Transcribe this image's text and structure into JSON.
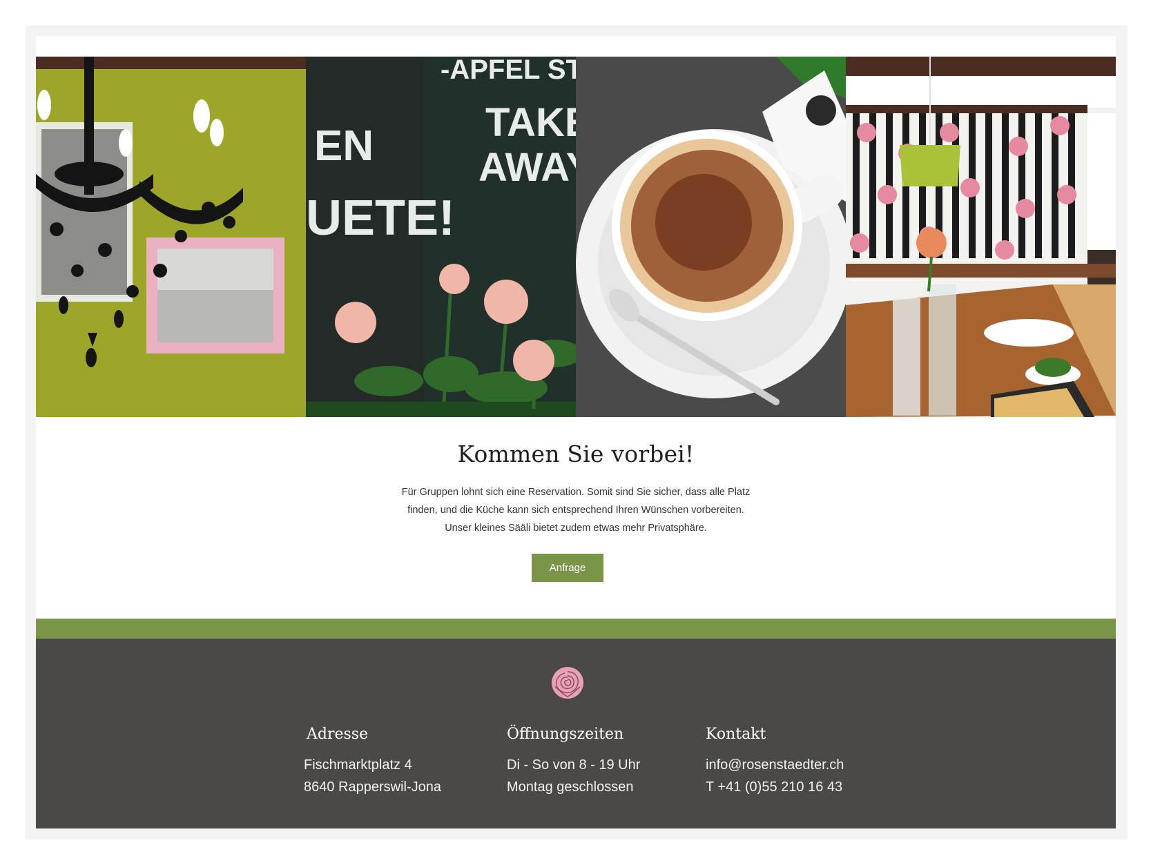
{
  "gallery": {
    "images": [
      {
        "name": "chandelier-photo",
        "alt": "chandelier-photo"
      },
      {
        "name": "chalkboard-roses-photo",
        "alt": "chalkboard-roses-photo"
      },
      {
        "name": "cappuccino-photo",
        "alt": "cappuccino-photo"
      },
      {
        "name": "dining-room-photo",
        "alt": "dining-room-photo"
      }
    ],
    "chalk_text": {
      "apfel": "-APFEL STRU",
      "en": "EN",
      "uete": "UETE!",
      "take": "TAKE",
      "away": "AWAY !"
    }
  },
  "cta": {
    "heading": "Kommen Sie vorbei!",
    "lines": [
      "Für Gruppen lohnt sich eine Reservation. Somit sind Sie sicher, dass alle Platz",
      "finden, und die Küche kann sich entsprechend Ihren Wünschen vorbereiten.",
      "Unser kleines Sääli bietet zudem etwas mehr Privatsphäre."
    ],
    "button_label": "Anfrage"
  },
  "footer": {
    "logo_icon": "rose-icon",
    "address": {
      "title": "Adresse",
      "line1": "Fischmarktplatz 4",
      "line2": "8640 Rapperswil-Jona"
    },
    "hours": {
      "title": "Öffnungszeiten",
      "line1": "Di - So von 8 - 19 Uhr",
      "line2": "Montag geschlossen"
    },
    "contact": {
      "title": "Kontakt",
      "email": "info@rosenstaedter.ch",
      "phone": "T +41 (0)55 210 16 43"
    }
  },
  "colors": {
    "accent_green": "#7a9448",
    "footer_bg": "#4a4946",
    "rose_pink": "#e6a1b4"
  }
}
